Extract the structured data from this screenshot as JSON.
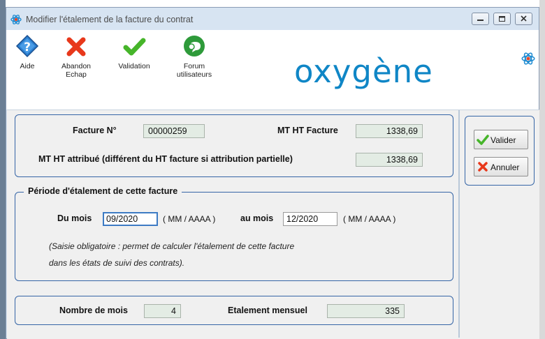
{
  "window": {
    "title": "Modifier l'étalement de la facture du contrat",
    "controls": [
      "minimize",
      "maximize",
      "close"
    ]
  },
  "toolbar": {
    "items": [
      {
        "label_line1": "Aide",
        "label_line2": "",
        "icon": "help-icon"
      },
      {
        "label_line1": "Abandon",
        "label_line2": "Echap",
        "icon": "red-x-icon"
      },
      {
        "label_line1": "Validation",
        "label_line2": "",
        "icon": "green-check-icon"
      },
      {
        "label_line1": "Forum",
        "label_line2": "utilisateurs",
        "icon": "forum-bubble-icon"
      }
    ],
    "brand": "oxygène"
  },
  "invoice": {
    "number_label": "Facture N°",
    "number_value": "00000259",
    "mt_ht_facture_label": "MT HT Facture",
    "mt_ht_facture_value": "1338,69",
    "mt_ht_attribue_label": "MT HT attribué (différent du HT facture si attribution partielle)",
    "mt_ht_attribue_value": "1338,69"
  },
  "period": {
    "legend": "Période d'étalement de cette facture",
    "from_label": "Du mois",
    "from_value": "09/2020",
    "from_format": "( MM / AAAA )",
    "to_label": "au mois",
    "to_value": "12/2020",
    "to_format": "( MM / AAAA )",
    "note_line1": "(Saisie obligatoire : permet de calculer l'étalement de cette facture",
    "note_line2": "dans les états de suivi des contrats)."
  },
  "summary": {
    "months_label": "Nombre de mois",
    "months_value": "4",
    "monthly_label": "Etalement mensuel",
    "monthly_value": "335"
  },
  "actions": {
    "validate_label": "Valider",
    "cancel_label": "Annuler"
  },
  "colors": {
    "accent_blue": "#0f86c6",
    "frame_border": "#3565a6",
    "readonly_bg": "#e3ece4",
    "title_bar": "#d7e4f2"
  }
}
